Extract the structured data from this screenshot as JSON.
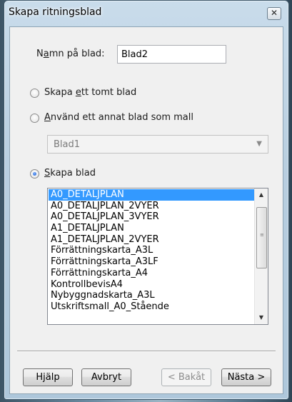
{
  "window": {
    "title": "Skapa ritningsblad",
    "close_symbol": "✕"
  },
  "name_field": {
    "label": "Namn på blad:",
    "value": "Blad2"
  },
  "options": {
    "empty": "Skapa ett tomt blad",
    "template": "Använd ett annat blad som mall",
    "template_value": "Blad1",
    "create": "Skapa blad"
  },
  "selected_option": "create",
  "list": {
    "items": [
      "A0_DETALJPLAN",
      "A0_DETALJPLAN_2VYER",
      "A0_DETALJPLAN_3VYER",
      "A1_DETALJPLAN",
      "A1_DETALJPLAN_2VYER",
      "Förrättningskarta_A3L",
      "Förrättningskarta_A3LF",
      "Förrättningskarta_A4",
      "KontrollbevisA4",
      "Nybyggnadskarta_A3L",
      "Utskriftsmall_A0_Stående"
    ],
    "selected_index": 0
  },
  "buttons": {
    "help": "Hjälp",
    "cancel": "Avbryt",
    "back": "< Bakåt",
    "next": "Nästa >"
  },
  "colors": {
    "selection": "#3399ff",
    "window_frame": "#b9cfe0"
  }
}
